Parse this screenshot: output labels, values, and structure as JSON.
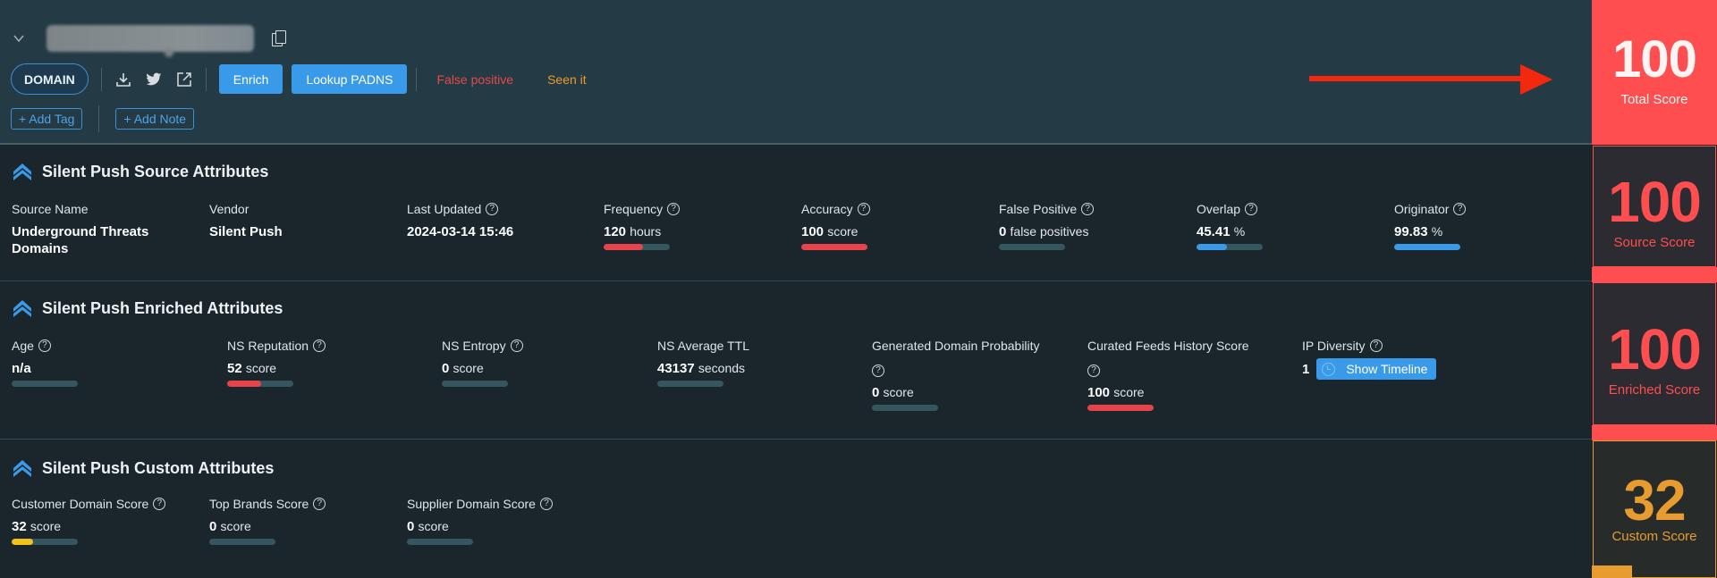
{
  "header": {
    "entity_type": "DOMAIN",
    "actions": {
      "enrich": "Enrich",
      "lookup_padns": "Lookup PADNS",
      "false_positive": "False positive",
      "seen_it": "Seen it",
      "add_tag": "+ Add Tag",
      "add_note": "+ Add Note"
    },
    "icons": [
      "chevron-down-icon",
      "copy-icon",
      "download-icon",
      "twitter-icon",
      "external-link-icon"
    ]
  },
  "source": {
    "title": "Silent Push Source Attributes",
    "source_name": {
      "label": "Source Name",
      "value": "Underground Threats Domains"
    },
    "vendor": {
      "label": "Vendor",
      "value": "Silent Push"
    },
    "last_updated": {
      "label": "Last Updated",
      "value": "2024-03-14 15:46"
    },
    "frequency": {
      "label": "Frequency",
      "value": "120",
      "unit": "hours",
      "bar_percent": 60,
      "bar_color": "red"
    },
    "accuracy": {
      "label": "Accuracy",
      "value": "100",
      "unit": "score",
      "bar_percent": 100,
      "bar_color": "red"
    },
    "false_positive": {
      "label": "False Positive",
      "value": "0",
      "unit": "false positives",
      "bar_percent": 0,
      "bar_color": "red"
    },
    "overlap": {
      "label": "Overlap",
      "value": "45.41",
      "unit": "%",
      "bar_percent": 45.41,
      "bar_color": "blue"
    },
    "originator": {
      "label": "Originator",
      "value": "99.83",
      "unit": "%",
      "bar_percent": 99.83,
      "bar_color": "blue"
    }
  },
  "enriched": {
    "title": "Silent Push Enriched Attributes",
    "age": {
      "label": "Age",
      "value": "n/a",
      "bar_percent": 0
    },
    "ns_reputation": {
      "label": "NS Reputation",
      "value": "52",
      "unit": "score",
      "bar_percent": 52,
      "bar_color": "red"
    },
    "ns_entropy": {
      "label": "NS Entropy",
      "value": "0",
      "unit": "score",
      "bar_percent": 0
    },
    "ns_avg_ttl": {
      "label": "NS Average TTL",
      "value": "43137",
      "unit": "seconds",
      "bar_percent": 0
    },
    "gen_domain_prob": {
      "label": "Generated Domain Probability",
      "value": "0",
      "unit": "score",
      "bar_percent": 0
    },
    "curated_feeds": {
      "label": "Curated Feeds History Score",
      "value": "100",
      "unit": "score",
      "bar_percent": 100,
      "bar_color": "red"
    },
    "ip_diversity": {
      "label": "IP Diversity",
      "value": "1",
      "button": "Show Timeline"
    }
  },
  "custom": {
    "title": "Silent Push Custom Attributes",
    "customer_domain": {
      "label": "Customer Domain Score",
      "value": "32",
      "unit": "score",
      "bar_percent": 32,
      "bar_color": "yellow"
    },
    "top_brands": {
      "label": "Top Brands Score",
      "value": "0",
      "unit": "score",
      "bar_percent": 0
    },
    "supplier_domain": {
      "label": "Supplier Domain Score",
      "value": "0",
      "unit": "score",
      "bar_percent": 0
    }
  },
  "scores": {
    "total": {
      "value": "100",
      "label": "Total Score",
      "percent": 100,
      "color": "#fe4e50"
    },
    "source": {
      "value": "100",
      "label": "Source Score",
      "percent": 100,
      "color": "#fe4e50"
    },
    "enriched": {
      "value": "100",
      "label": "Enriched Score",
      "percent": 100,
      "color": "#fe4e50"
    },
    "custom": {
      "value": "32",
      "label": "Custom Score",
      "percent": 32,
      "color": "#e89c2f"
    }
  }
}
